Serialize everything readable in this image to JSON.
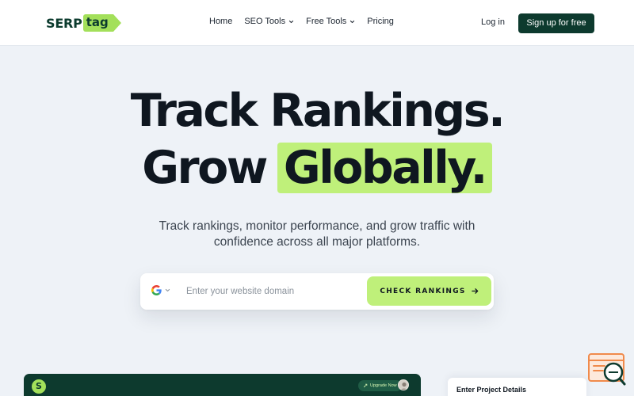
{
  "nav": {
    "logo": {
      "part1": "SERP",
      "part2": "tag"
    },
    "links": [
      {
        "label": "Home",
        "has_dropdown": false
      },
      {
        "label": "SEO Tools",
        "has_dropdown": true
      },
      {
        "label": "Free Tools",
        "has_dropdown": true
      },
      {
        "label": "Pricing",
        "has_dropdown": false
      }
    ],
    "login": "Log in",
    "signup": "Sign up for free"
  },
  "hero": {
    "line1": "Track Rankings.",
    "line2_prefix": "Grow",
    "line2_highlight": "Globally.",
    "subtitle_line1": "Track rankings, monitor performance, and grow traffic with",
    "subtitle_line2": "confidence across all major platforms."
  },
  "search": {
    "engine_icon": "google-icon",
    "placeholder": "Enter your website domain",
    "value": "",
    "button": "CHECK RANKINGS"
  },
  "preview": {
    "dashboard_logo": "S",
    "upgrade": "Upgrade Now",
    "project_title": "Enter Project Details"
  },
  "colors": {
    "brand_dark": "#0d3a2e",
    "brand_lime": "#a3e05a",
    "highlight": "#bff07a",
    "background": "#eef2f7"
  }
}
